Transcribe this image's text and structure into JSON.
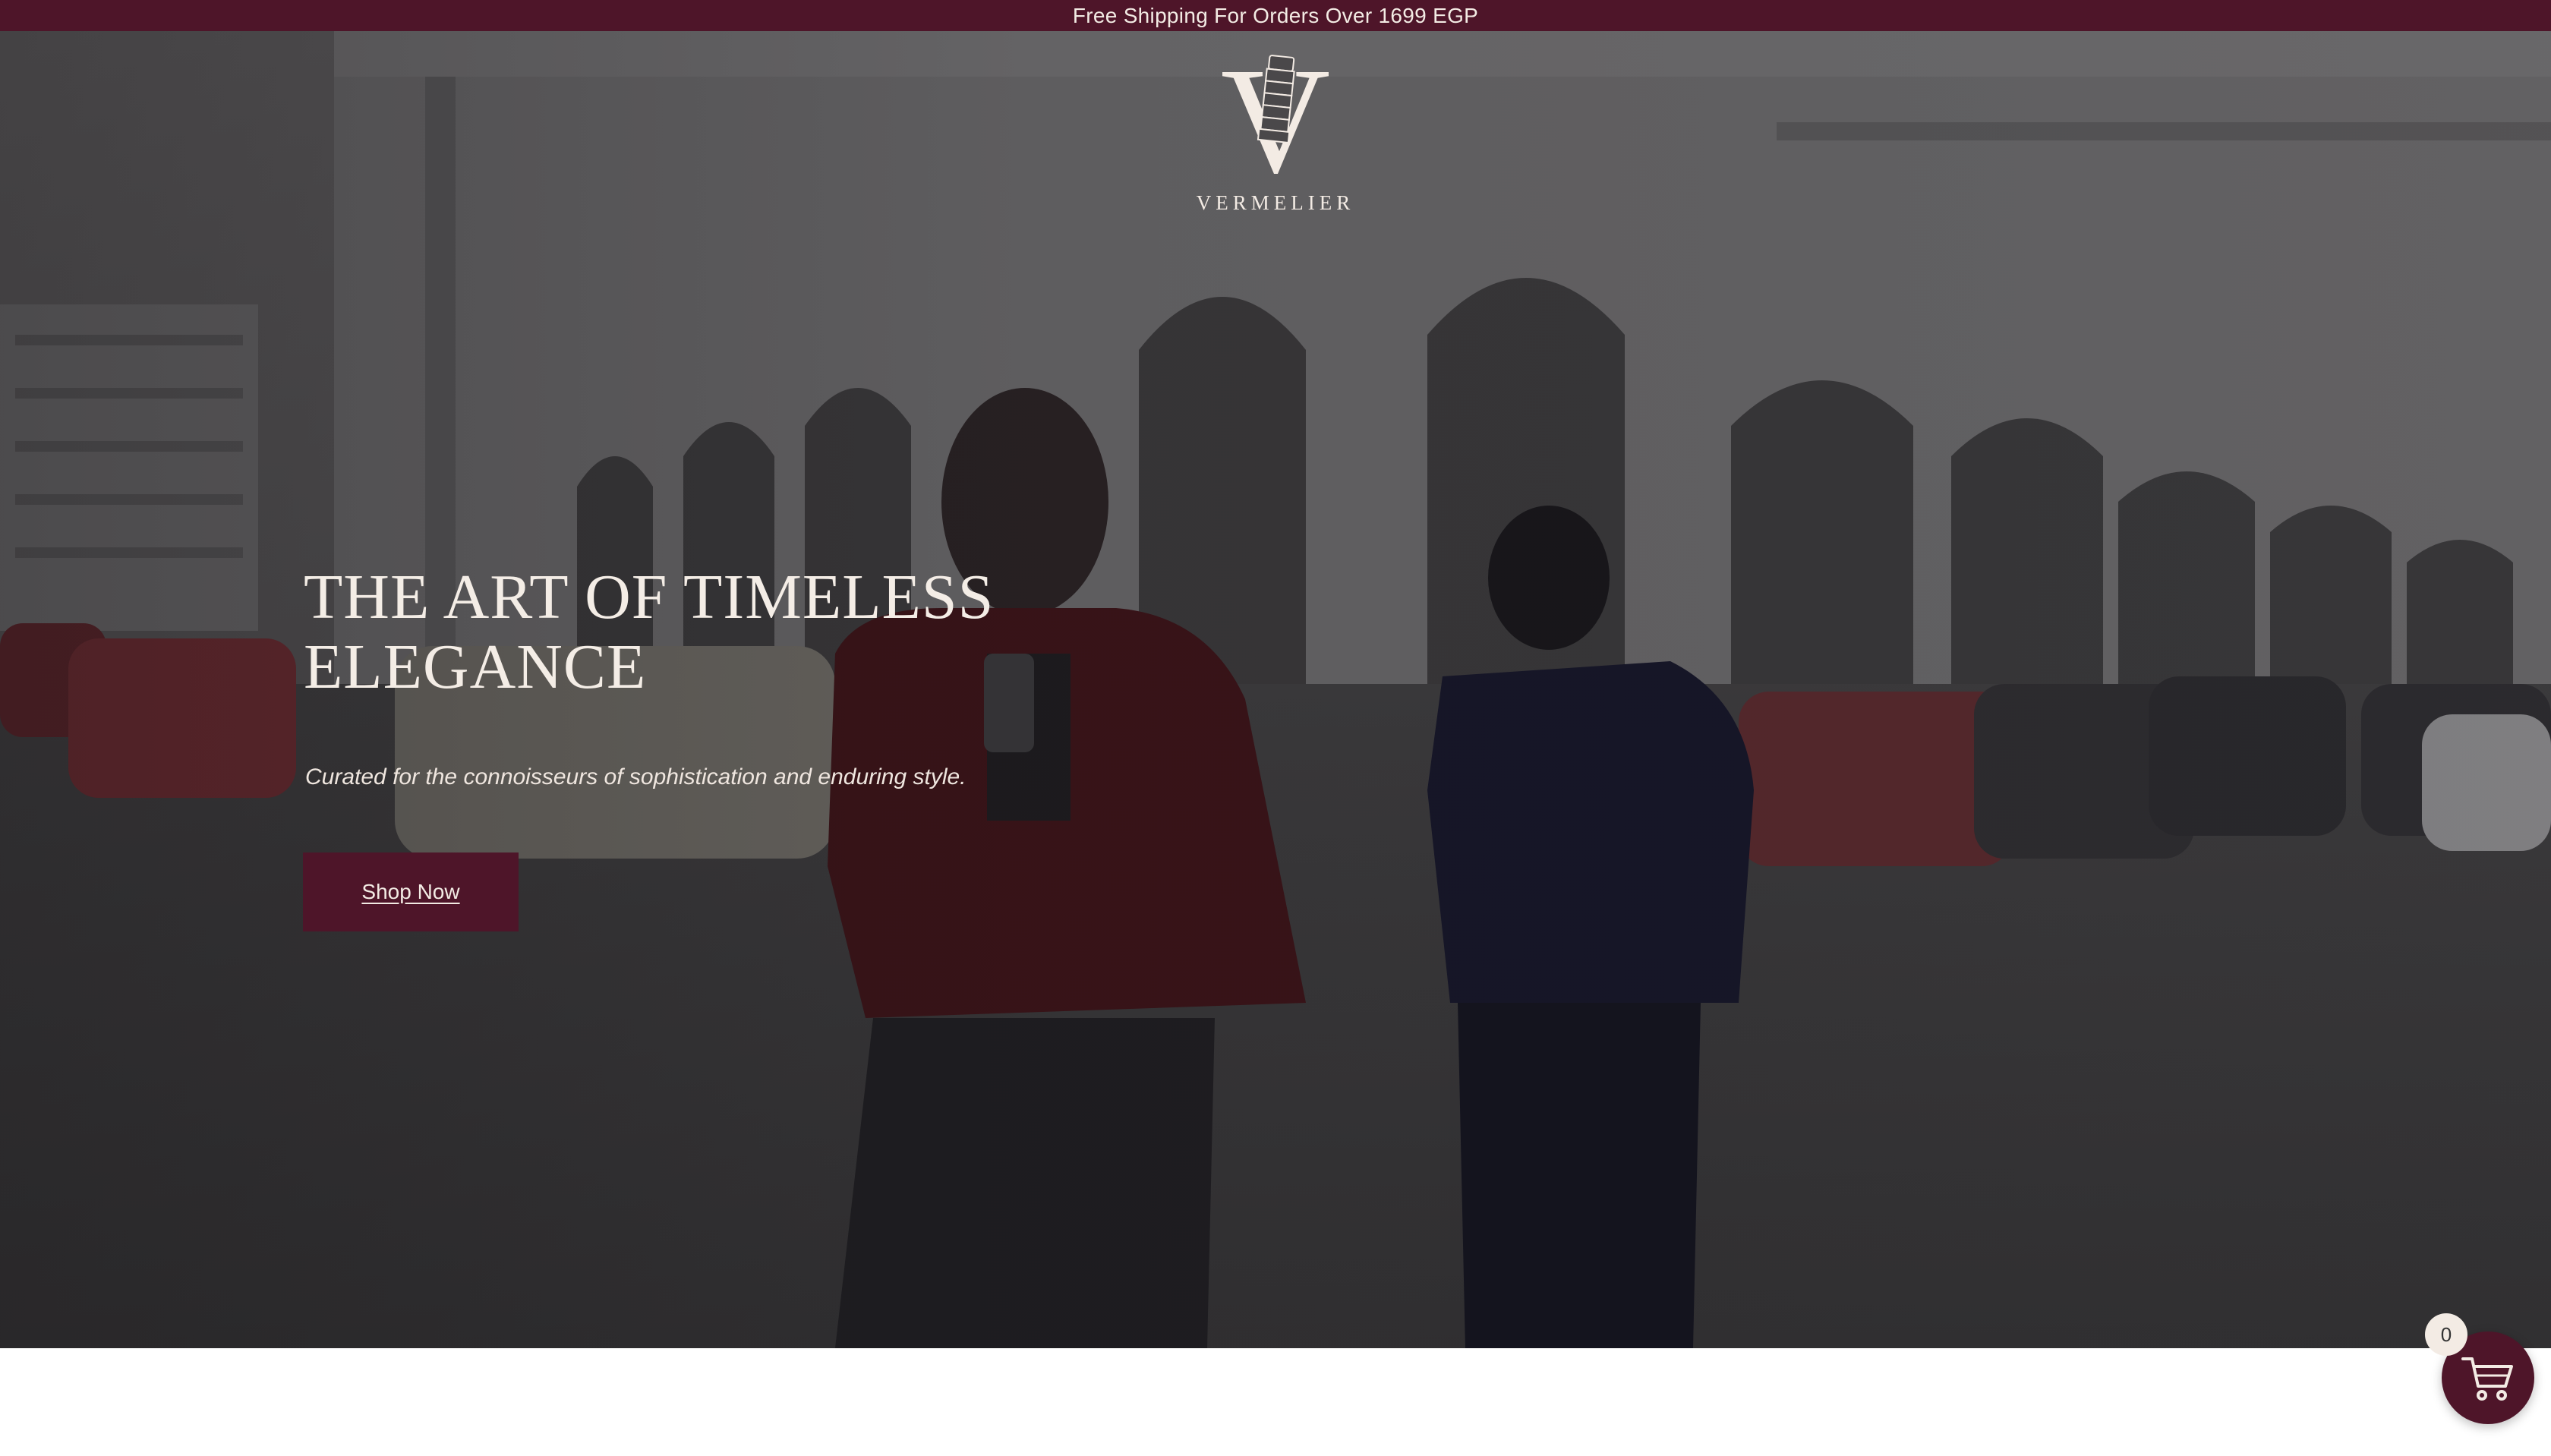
{
  "announcement": {
    "text": "Free Shipping For Orders Over 1699 EGP"
  },
  "brand": {
    "name": "VERMELIER",
    "monogram": "V",
    "logo_icon": "leaning-tower-icon"
  },
  "hero": {
    "title": "THE ART OF TIMELESS ELEGANCE",
    "subtitle": "Curated for the connoisseurs of sophistication and enduring style.",
    "cta_label": "Shop Now"
  },
  "cart": {
    "count": "0",
    "icon": "cart-icon"
  },
  "colors": {
    "brand_burgundy": "#4e1529",
    "cream": "#f3ebe4"
  }
}
